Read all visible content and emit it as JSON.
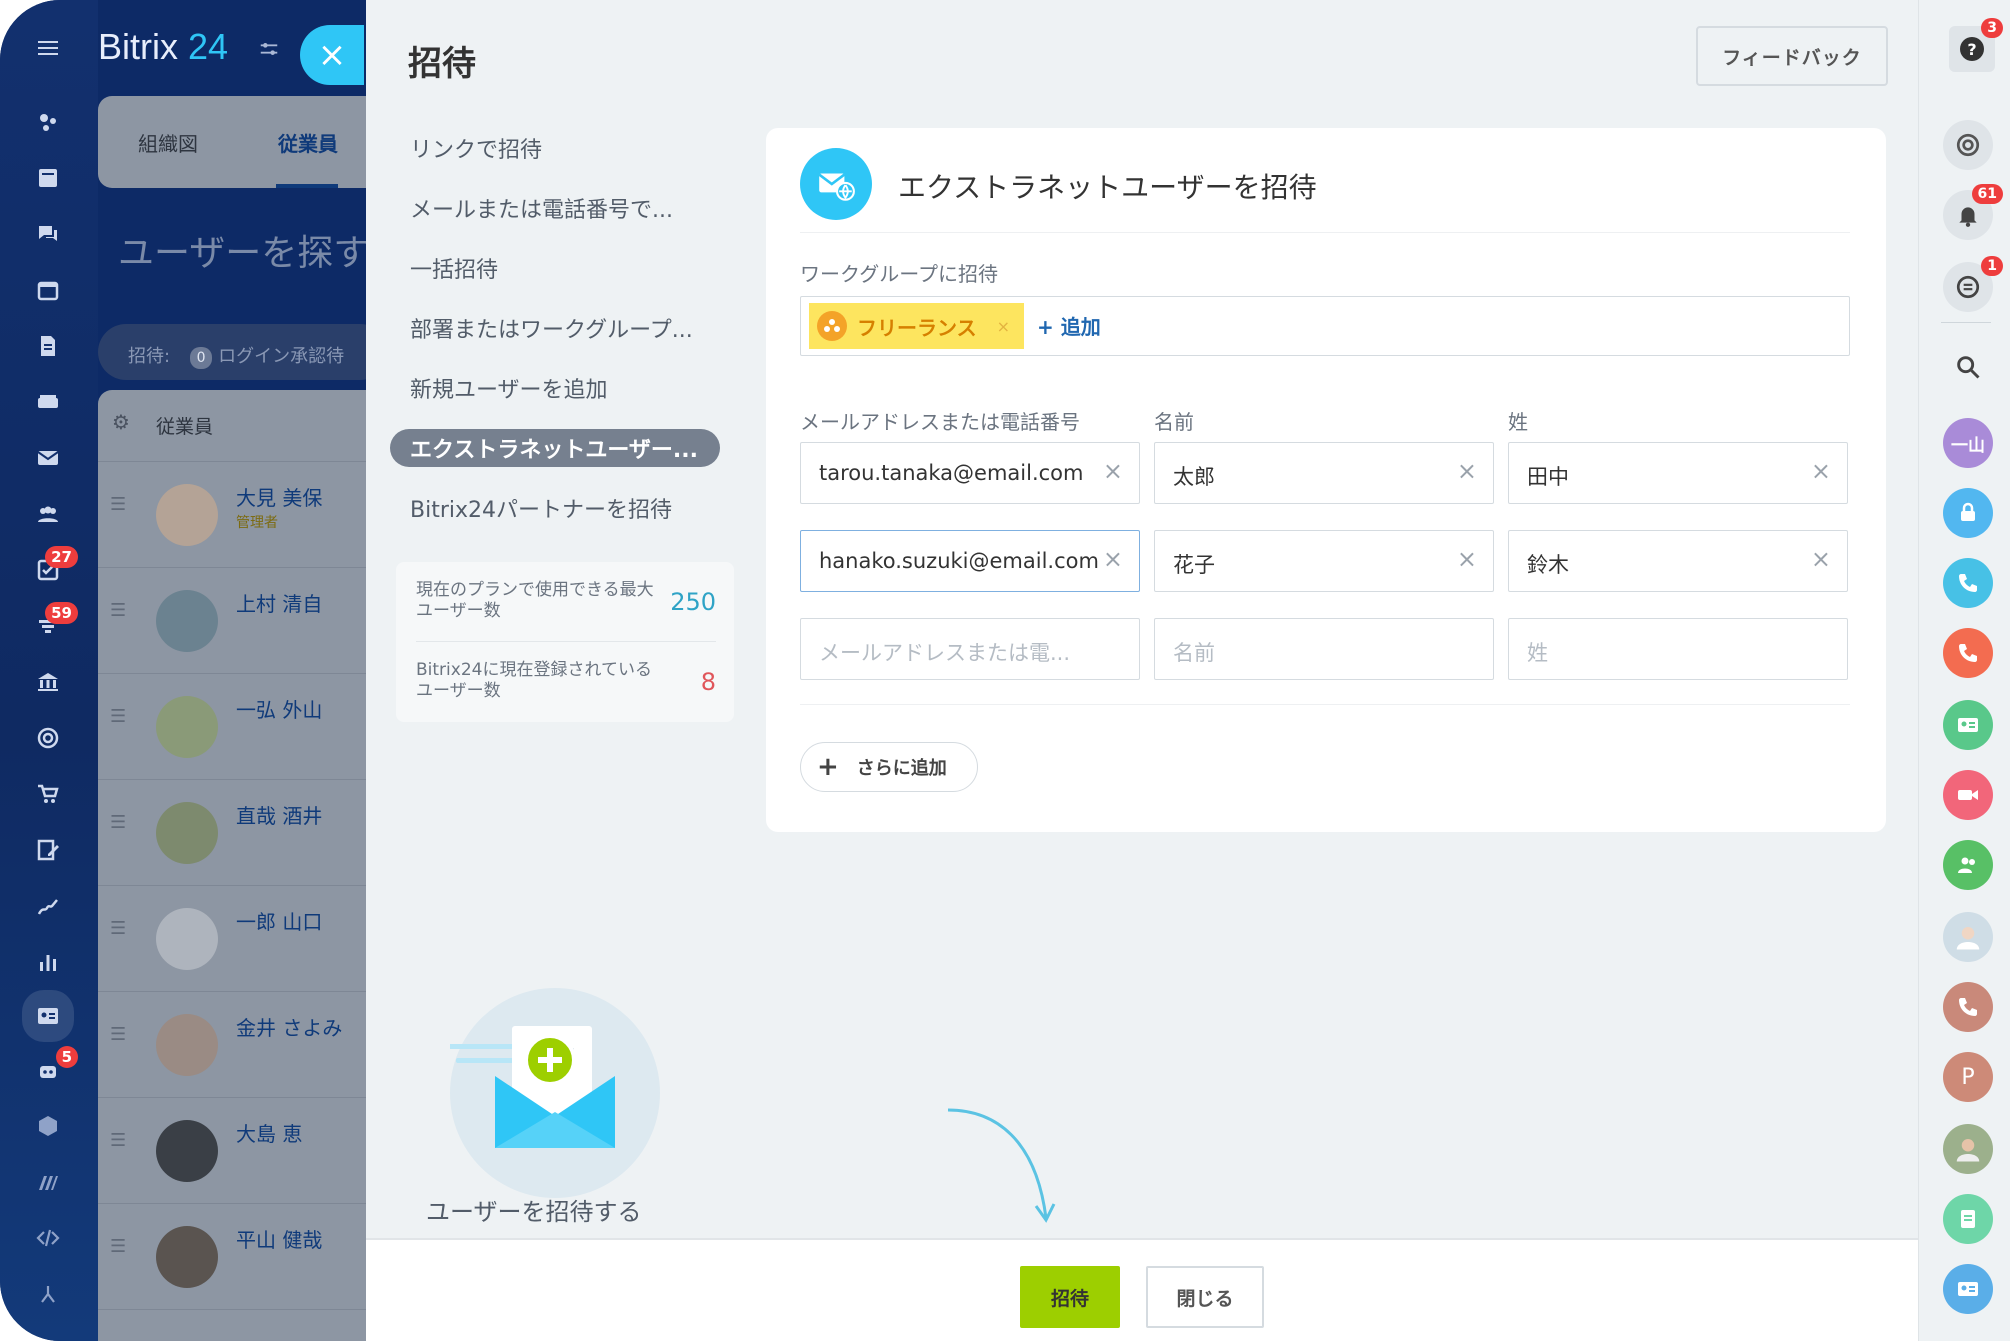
{
  "app": {
    "logo_brand": "Bitrix",
    "logo_number": "24",
    "close_symbol": "×"
  },
  "rail": {
    "badges": [
      "27",
      "59",
      "5"
    ]
  },
  "background_page": {
    "tabs": [
      "組織図",
      "従業員"
    ],
    "title": "ユーザーを探す",
    "filter_label": "招待:",
    "filter_count": "0",
    "filter_text": "ログイン承認待",
    "list_header": "従業員",
    "employees": [
      {
        "name": "大見 美保",
        "role": "管理者"
      },
      {
        "name": "上村 清自",
        "role": ""
      },
      {
        "name": "一弘 外山",
        "role": ""
      },
      {
        "name": "直哉 酒井",
        "role": ""
      },
      {
        "name": "一郎 山口",
        "role": ""
      },
      {
        "name": "金井 さよみ",
        "role": ""
      },
      {
        "name": "大島 恵",
        "role": ""
      },
      {
        "name": "平山 健哉",
        "role": ""
      }
    ]
  },
  "panel": {
    "title": "招待",
    "feedback_label": "フィードバック",
    "menu": [
      "リンクで招待",
      "メールまたは電話番号で...",
      "一括招待",
      "部署またはワークグループ...",
      "新規ユーザーを追加",
      "エクストラネットユーザー...",
      "Bitrix24パートナーを招待"
    ],
    "stats": {
      "max_users_label": "現在のプランで使用できる最大ユーザー数",
      "max_users_value": "250",
      "current_users_label": "Bitrix24に現在登録されているユーザー数",
      "current_users_value": "8",
      "max_color": "#2fa3c6",
      "current_color": "#e0565b"
    },
    "illustration_label": "ユーザーを招待する",
    "card": {
      "title": "エクストラネットユーザーを招待",
      "workgroup_label": "ワークグループに招待",
      "workgroup_tag": "フリーランス",
      "workgroup_tag_remove": "×",
      "workgroup_add": "+ 追加",
      "columns": [
        "メールアドレスまたは電話番号",
        "名前",
        "姓"
      ],
      "rows": [
        {
          "email": "tarou.tanaka@email.com",
          "first": "太郎",
          "last": "田中"
        },
        {
          "email": "hanako.suzuki@email.com",
          "first": "花子",
          "last": "鈴木"
        }
      ],
      "placeholders": {
        "email": "メールアドレスまたは電...",
        "first": "名前",
        "last": "姓"
      },
      "clear_symbol": "×",
      "add_more_label": "さらに追加"
    },
    "footer": {
      "invite_label": "招待",
      "close_label": "閉じる"
    }
  },
  "right_bar": {
    "help_badge": "3",
    "notif_badge": "61",
    "chat_badge": "1",
    "user_initials": "一山",
    "p_initial": "P"
  },
  "colors": {
    "accent": "#2fc6f6",
    "invite_button": "#9dcf00",
    "tag_bg": "#fde55f"
  }
}
